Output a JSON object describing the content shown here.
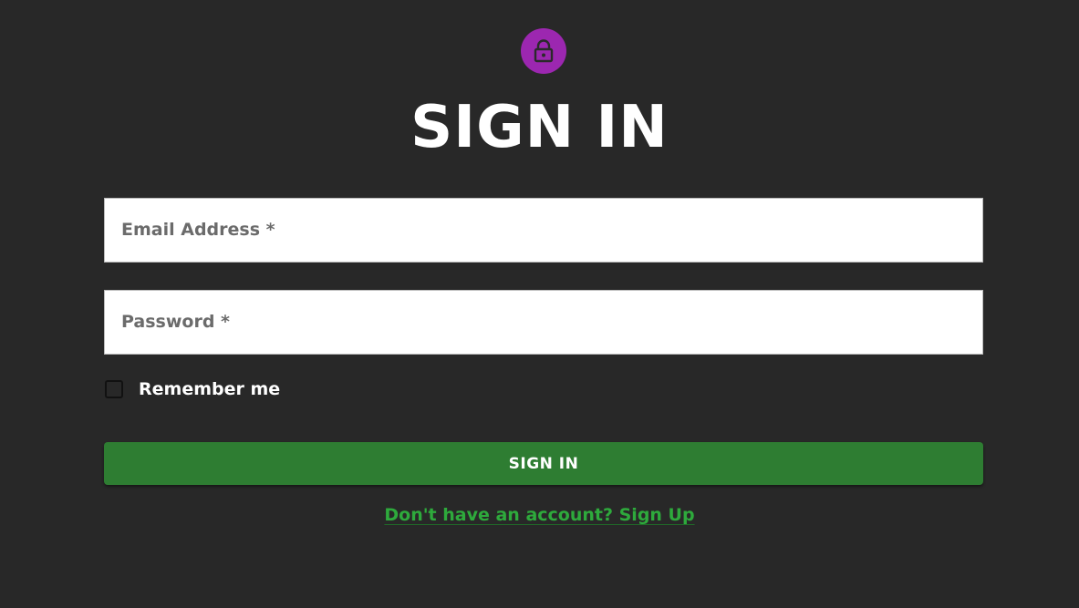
{
  "header": {
    "icon": "lock-icon",
    "icon_bg_color": "#9c27b0",
    "title": "SIGN IN"
  },
  "form": {
    "email": {
      "label": "Email Address *",
      "value": ""
    },
    "password": {
      "label": "Password *",
      "value": ""
    },
    "remember": {
      "label": "Remember me",
      "checked": false
    },
    "submit_label": "SIGN IN",
    "signup_link": "Don't have an account? Sign Up"
  },
  "colors": {
    "background": "#282828",
    "primary_button": "#2e7d32",
    "link": "#2eaa3c"
  }
}
